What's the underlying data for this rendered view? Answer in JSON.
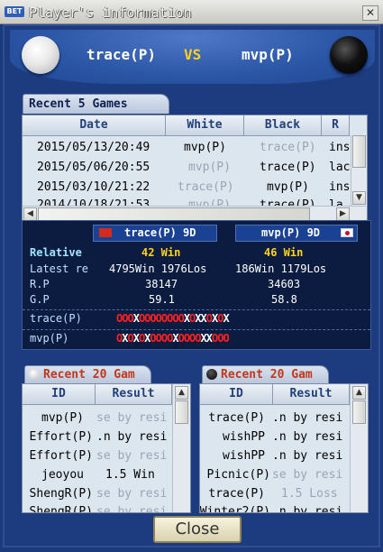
{
  "window": {
    "badge": "BET",
    "title": "Player's information",
    "close_glyph": "✕"
  },
  "header": {
    "white_player": "trace(P)",
    "vs": "VS",
    "black_player": "mvp(P)"
  },
  "recent_games": {
    "tab_label": "Recent 5  Games",
    "columns": [
      "Date",
      "White",
      "Black",
      "R"
    ],
    "rows": [
      {
        "date": "2015/05/13/20:49",
        "white": "mvp(P)",
        "black": "trace(P)",
        "result": "ins",
        "white_dim": false,
        "black_dim": true
      },
      {
        "date": "2015/05/06/20:55",
        "white": "mvp(P)",
        "black": "trace(P)",
        "result": "lac",
        "white_dim": true,
        "black_dim": false
      },
      {
        "date": "2015/03/10/21:22",
        "white": "trace(P)",
        "black": "mvp(P)",
        "result": "ins",
        "white_dim": true,
        "black_dim": false
      },
      {
        "date": "2014/10/18/21:53",
        "white": "mvp(P)",
        "black": "trace(P)",
        "result": "la",
        "white_dim": true,
        "black_dim": false
      }
    ]
  },
  "stats": {
    "left_player": "trace(P) 9D",
    "right_player": "mvp(P) 9D",
    "relative_label": "Relative",
    "left_relative": "42 Win",
    "right_relative": "46 Win",
    "latest_label": "Latest re",
    "left_latest": "4795Win 1976Los",
    "right_latest": "186Win 1179Los",
    "rp_label": "R.P",
    "left_rp": "38147",
    "right_rp": "34603",
    "gp_label": "G.P",
    "left_gp": "59.1",
    "right_gp": "58.8",
    "trace_label": "trace(P)",
    "trace_seq": "OOOXOOOOOOOOXOXXOXOX",
    "mvp_label": "mvp(P)",
    "mvp_seq": "OXOXOXOOOOXOOOOXXOOO"
  },
  "recent20_left": {
    "tab_label": "Recent 20 Gam",
    "columns": [
      "ID",
      "Result"
    ],
    "rows": [
      {
        "id": "mvp(P)",
        "result": "se by resi",
        "dim": true
      },
      {
        "id": "Effort(P)",
        "result": ".n by resi",
        "dim": false
      },
      {
        "id": "Effort(P)",
        "result": "se by resi",
        "dim": true
      },
      {
        "id": "jeoyou",
        "result": "1.5 Win",
        "dim": false
      },
      {
        "id": "ShengR(P)",
        "result": "se by resi",
        "dim": true
      },
      {
        "id": "ShengR(P)",
        "result": "se by resi",
        "dim": true
      }
    ]
  },
  "recent20_right": {
    "tab_label": "Recent 20 Gam",
    "columns": [
      "ID",
      "Result"
    ],
    "rows": [
      {
        "id": "trace(P)",
        "result": ".n by resi",
        "dim": false
      },
      {
        "id": "wishPP",
        "result": ".n by resi",
        "dim": false
      },
      {
        "id": "wishPP",
        "result": ".n by resi",
        "dim": false
      },
      {
        "id": "Picnic(P)",
        "result": "se by resi",
        "dim": true
      },
      {
        "id": "trace(P)",
        "result": "1.5 Loss",
        "dim": true
      },
      {
        "id": "Winter2(P)",
        "result": ".n by resi",
        "dim": false
      }
    ]
  },
  "footer": {
    "close_label": "Close"
  },
  "colors": {
    "background": "#1c3a7a",
    "win_yellow": "#ffd21c",
    "seq_win": "#ff2020",
    "seq_loss": "#ffffff",
    "dim_text": "#9aa4b6"
  }
}
